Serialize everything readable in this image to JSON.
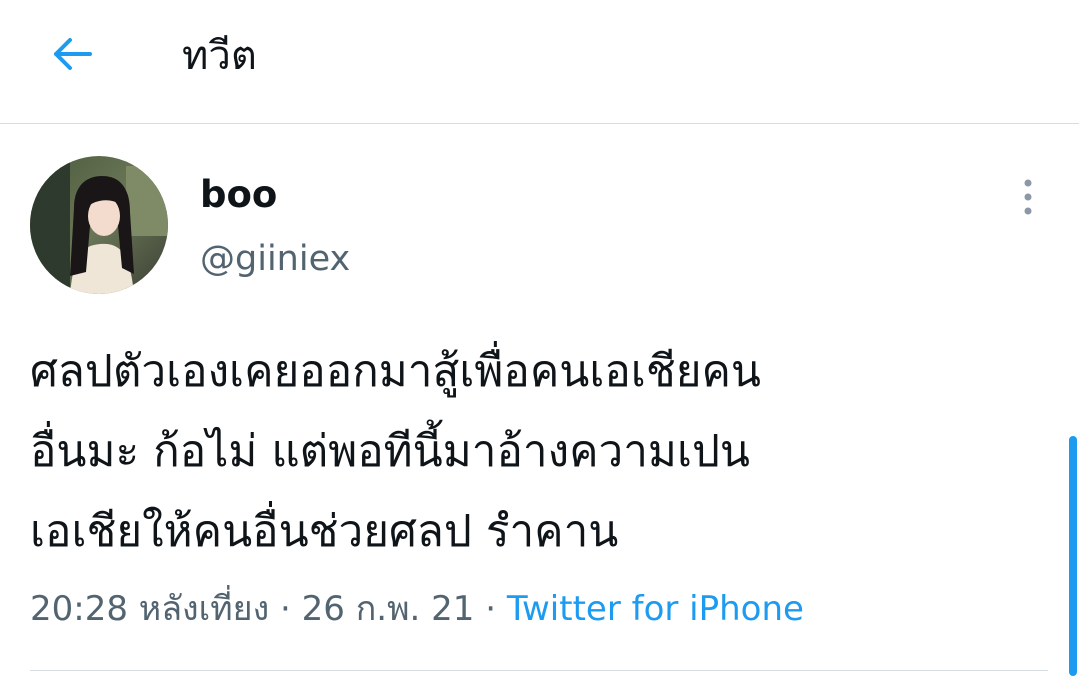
{
  "header": {
    "title": "ทวีต",
    "back_icon": "arrow-left-icon"
  },
  "tweet": {
    "author": {
      "display_name": "boo",
      "handle": "@giiniex"
    },
    "text_lines": [
      "ศลปตัวเองเคยออกมาสู้เพื่อคนเอเชียคน",
      "อื่นมะ ก้อไม่ แต่พอทีนี้มาอ้างความเปน",
      "เอเชียให้คนอื่นช่วยศลป รำคาน"
    ],
    "time": "20:28 หลังเที่ยง",
    "separator": "·",
    "date": "26 ก.พ. 21",
    "source": "Twitter for iPhone"
  },
  "colors": {
    "accent": "#1d9bf0",
    "secondary_text": "#536471",
    "divider": "#d6dde2"
  }
}
